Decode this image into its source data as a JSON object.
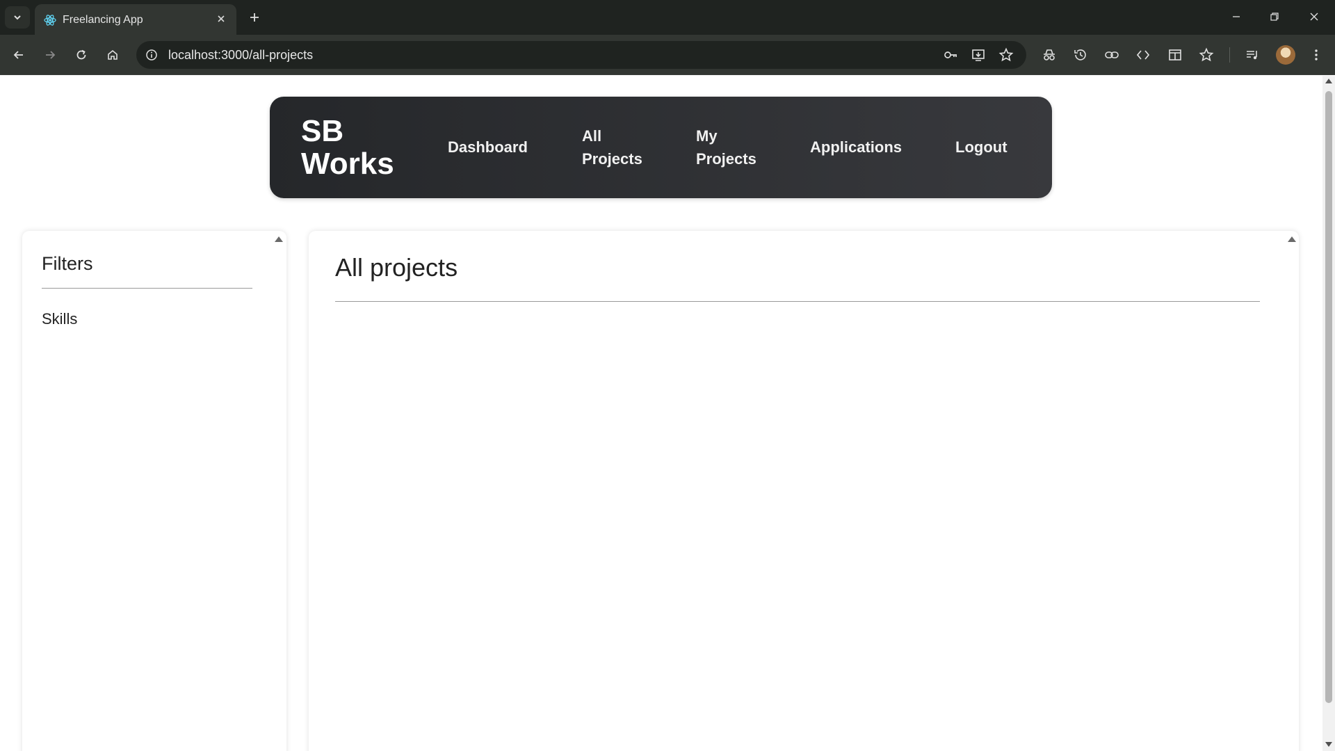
{
  "browser": {
    "tab_title": "Freelancing App",
    "url": "localhost:3000/all-projects"
  },
  "navbar": {
    "brand": "SB Works",
    "links": [
      {
        "label": "Dashboard"
      },
      {
        "label": "All Projects"
      },
      {
        "label": "My Projects"
      },
      {
        "label": "Applications"
      },
      {
        "label": "Logout"
      }
    ]
  },
  "filters": {
    "title": "Filters",
    "skills_label": "Skills"
  },
  "projects": {
    "title": "All projects"
  },
  "colors": {
    "navbar_bg": "#2c2e31",
    "chrome_dark": "#1f2320",
    "chrome_toolbar": "#323632"
  }
}
